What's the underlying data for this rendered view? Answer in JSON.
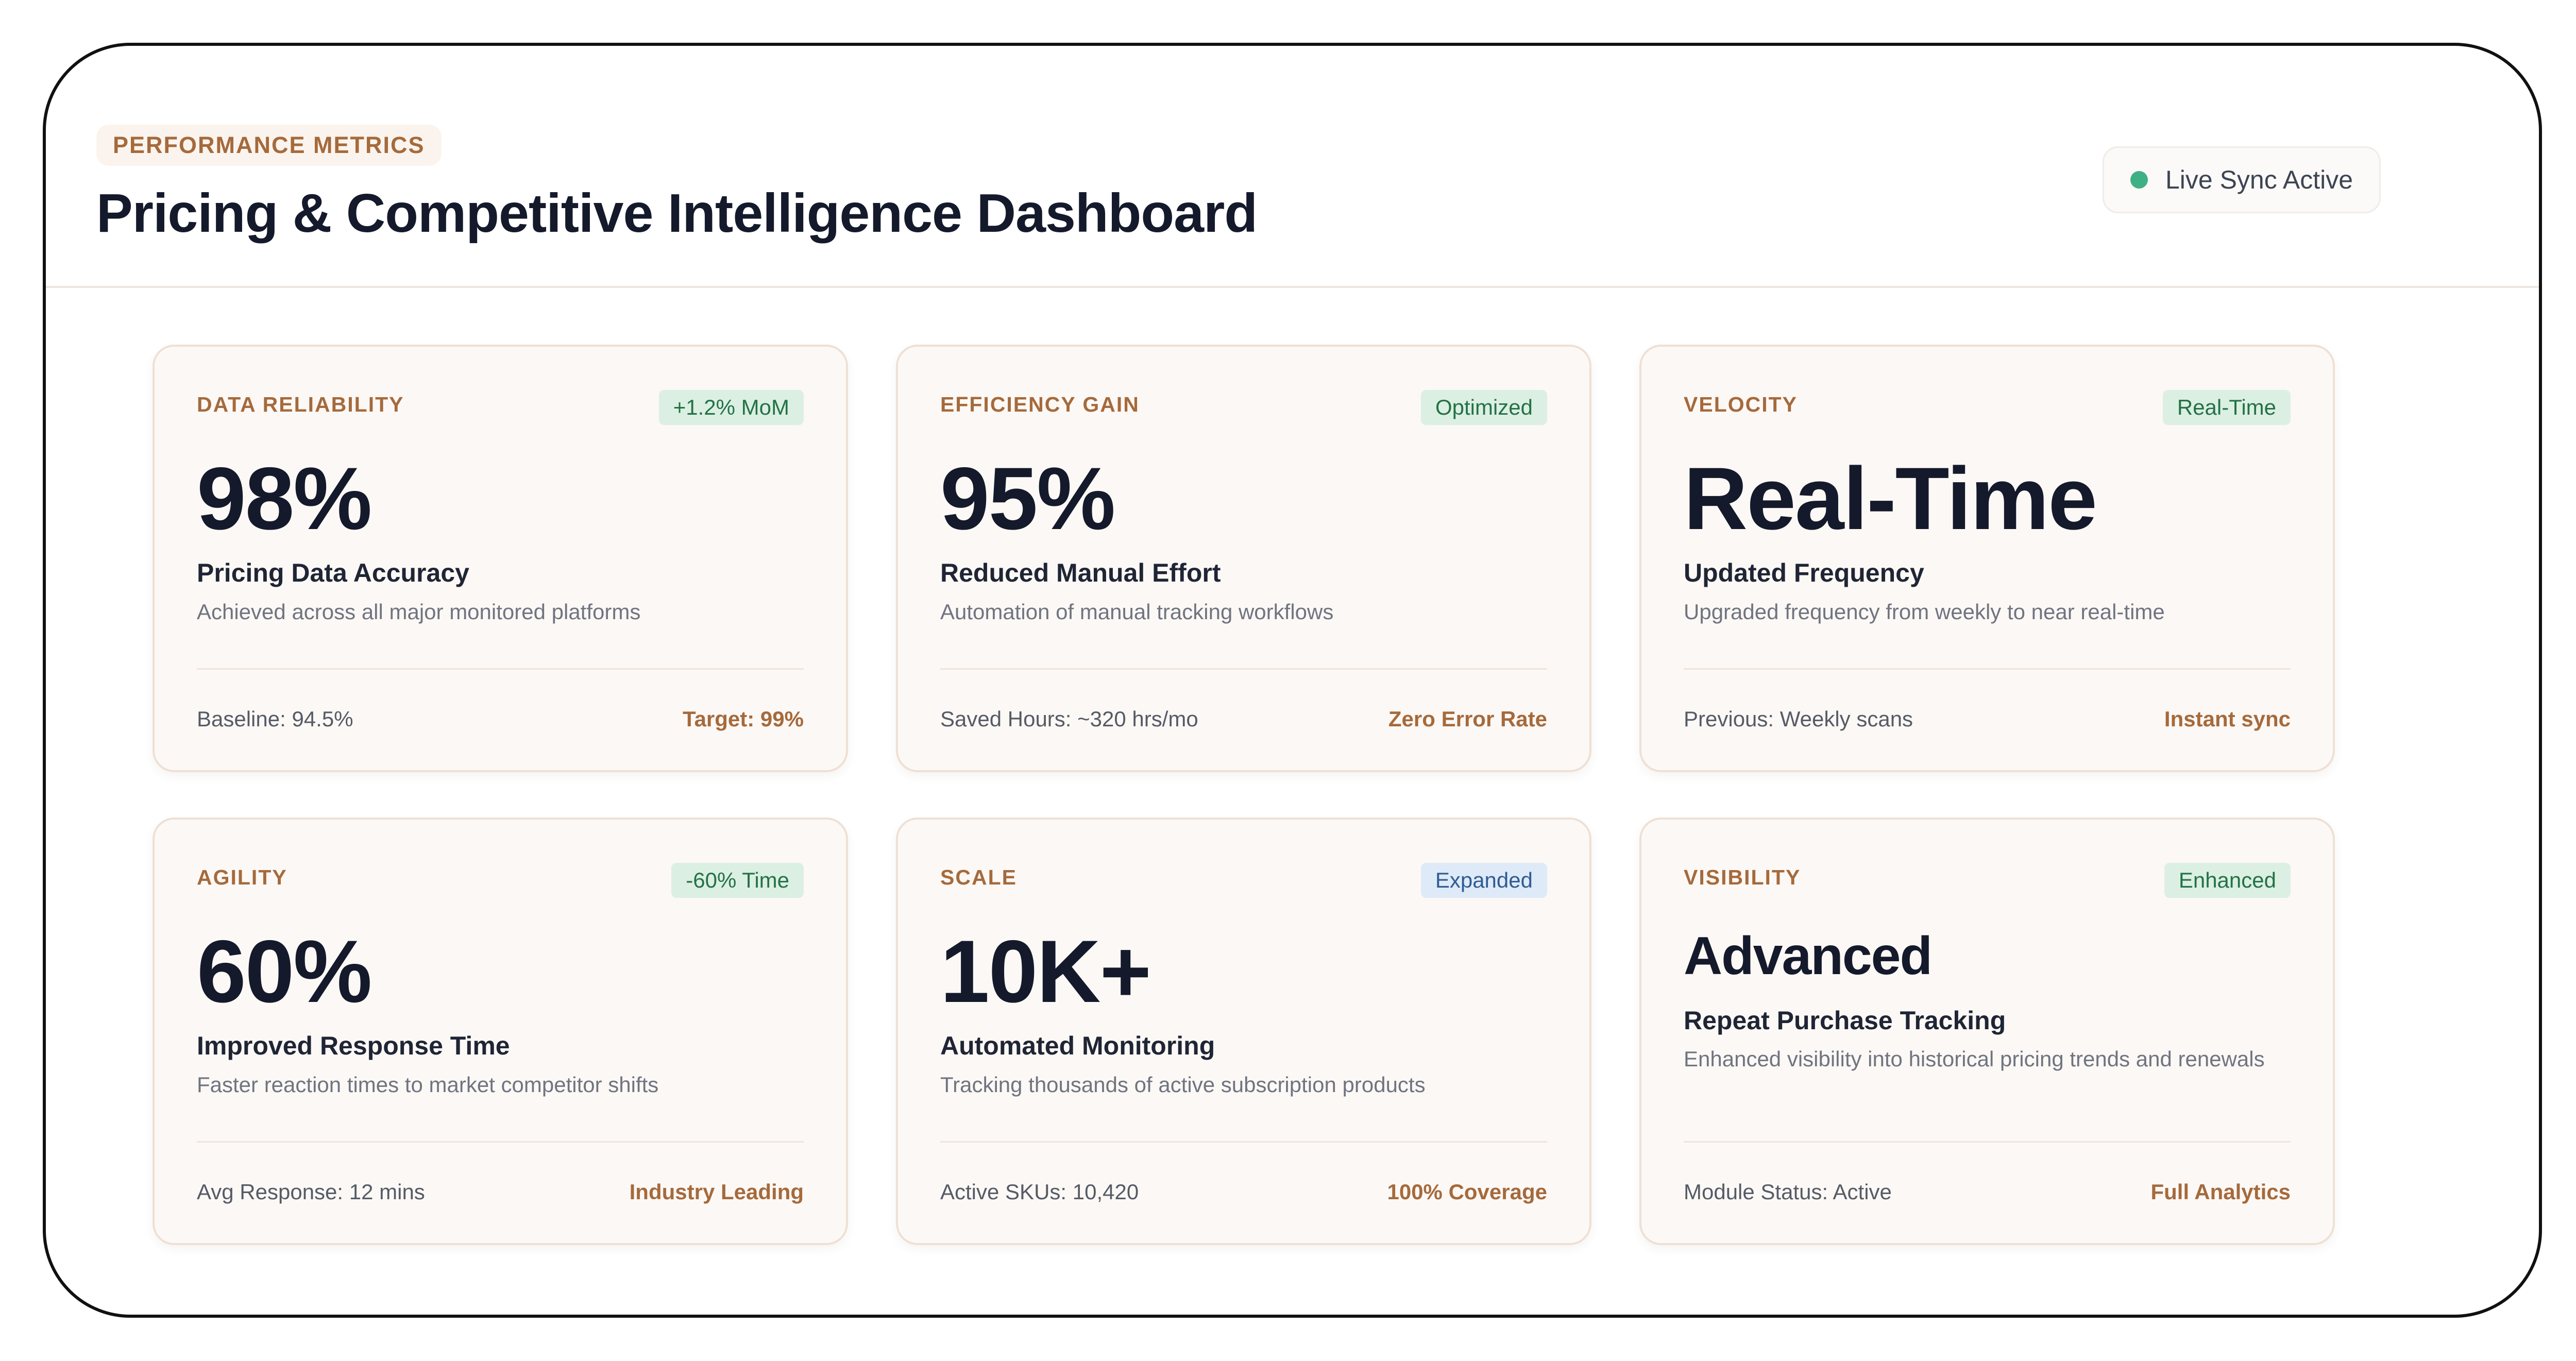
{
  "header": {
    "eyebrow": "PERFORMANCE METRICS",
    "title": "Pricing & Competitive Intelligence Dashboard",
    "sync_status": "Live Sync Active"
  },
  "colors": {
    "accent": "#a56a3c",
    "heading": "#141a2b",
    "status_dot": "#3fb085",
    "badge_green_bg": "#dcefe3",
    "badge_green_text": "#237246",
    "badge_blue_bg": "#dfeaf8",
    "badge_blue_text": "#2f5c92"
  },
  "cards": [
    {
      "category": "DATA RELIABILITY",
      "badge": "+1.2% MoM",
      "value": "98%",
      "label": "Pricing Data Accuracy",
      "description": "Achieved across all major monitored platforms",
      "footer_left": "Baseline: 94.5%",
      "footer_right": "Target: 99%"
    },
    {
      "category": "EFFICIENCY GAIN",
      "badge": "Optimized",
      "value": "95%",
      "label": "Reduced Manual Effort",
      "description": "Automation of manual tracking workflows",
      "footer_left": "Saved Hours: ~320 hrs/mo",
      "footer_right": "Zero Error Rate"
    },
    {
      "category": "VELOCITY",
      "badge": "Real-Time",
      "value": "Real-Time",
      "label": "Updated Frequency",
      "description": "Upgraded frequency from weekly to near real-time",
      "footer_left": "Previous: Weekly scans",
      "footer_right": "Instant sync"
    },
    {
      "category": "AGILITY",
      "badge": "-60% Time",
      "value": "60%",
      "label": "Improved Response Time",
      "description": "Faster reaction times to market competitor shifts",
      "footer_left": "Avg Response: 12 mins",
      "footer_right": "Industry Leading"
    },
    {
      "category": "SCALE",
      "badge": "Expanded",
      "value": "10K+",
      "label": "Automated Monitoring",
      "description": "Tracking thousands of active subscription products",
      "footer_left": "Active SKUs: 10,420",
      "footer_right": "100% Coverage"
    },
    {
      "category": "VISIBILITY",
      "badge": "Enhanced",
      "value": "Advanced",
      "label": "Repeat Purchase Tracking",
      "description": "Enhanced visibility into historical pricing trends and renewals",
      "footer_left": "Module Status: Active",
      "footer_right": "Full Analytics"
    }
  ]
}
